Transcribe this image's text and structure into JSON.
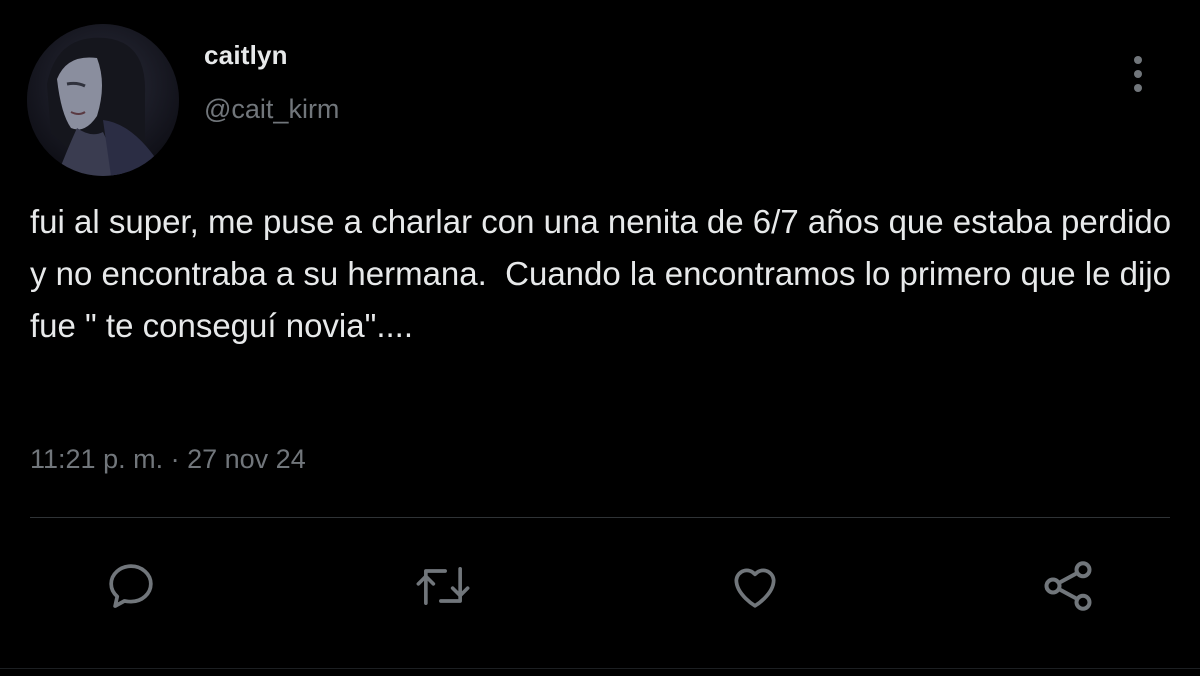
{
  "user": {
    "display_name": "caitlyn",
    "handle": "@cait_kirm",
    "avatar": "profile-avatar"
  },
  "tweet": {
    "text": "fui al super, me puse a charlar con una nenita de 6/7 años que estaba perdido y no encontraba a su hermana.  Cuando la encontramos lo primero que le dijo fue \" te conseguí novia\"....",
    "time": "11:21 p. m.",
    "separator": "·",
    "date": "27 nov 24"
  },
  "actions": {
    "icons": [
      "reply-icon",
      "retweet-icon",
      "like-icon",
      "share-icon"
    ]
  },
  "colors": {
    "background": "#000000",
    "text": "#e7e9ea",
    "secondary": "#71767b",
    "divider": "#2f3336"
  }
}
